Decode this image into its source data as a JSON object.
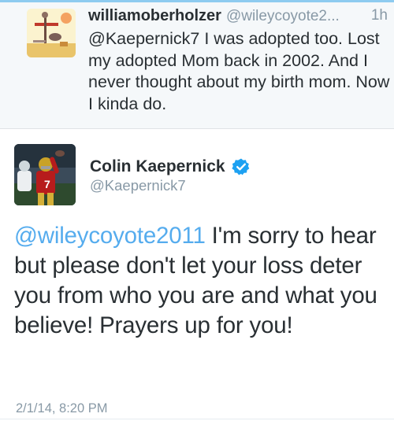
{
  "reply_tweet": {
    "display_name": "williamoberholzer",
    "handle": "@wileycoyote2...",
    "time": "1h",
    "text": "@Kaepernick7 I was adopted too. Lost my adopted Mom back in 2002. And I never thought about my birth mom. Now I kinda do.",
    "avatar_icon": "cartoon-avatar-icon"
  },
  "main_tweet": {
    "display_name": "Colin Kaepernick",
    "handle": "@Kaepernick7",
    "verified_icon": "verified-badge-icon",
    "mention": "@wileycoyote2011",
    "text": " I'm sorry to hear but please don't let your loss deter you from who you are and what you believe!  Prayers up for you!",
    "date": "2/1/14, 8:20 PM",
    "avatar_icon": "football-player-avatar-icon"
  },
  "colors": {
    "link": "#55acee",
    "secondary_text": "#8899a6",
    "primary_text": "#292f33",
    "reply_background": "#f5f8fa",
    "verified": "#1da1f2"
  }
}
